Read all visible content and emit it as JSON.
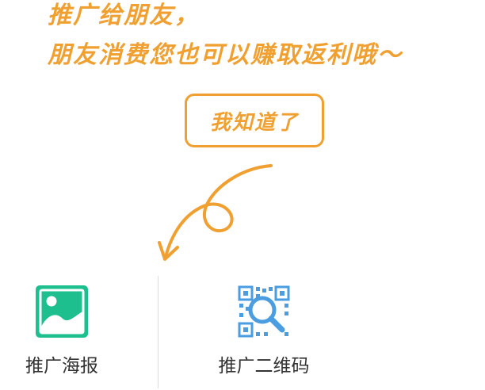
{
  "tip": {
    "line1": "推广给朋友，",
    "line2": "朋友消费您也可以赚取返利哦～"
  },
  "got_it_button": {
    "label": "我知道了"
  },
  "share_options": [
    {
      "label": "推广海报",
      "icon": "poster-image-icon"
    },
    {
      "label": "推广二维码",
      "icon": "qrcode-search-icon"
    }
  ],
  "colors": {
    "accent": "#f0a030",
    "poster_icon": "#1dbf8f",
    "qrcode_icon": "#4a9de0",
    "label_text": "#333333",
    "divider": "#dcdcdc"
  }
}
